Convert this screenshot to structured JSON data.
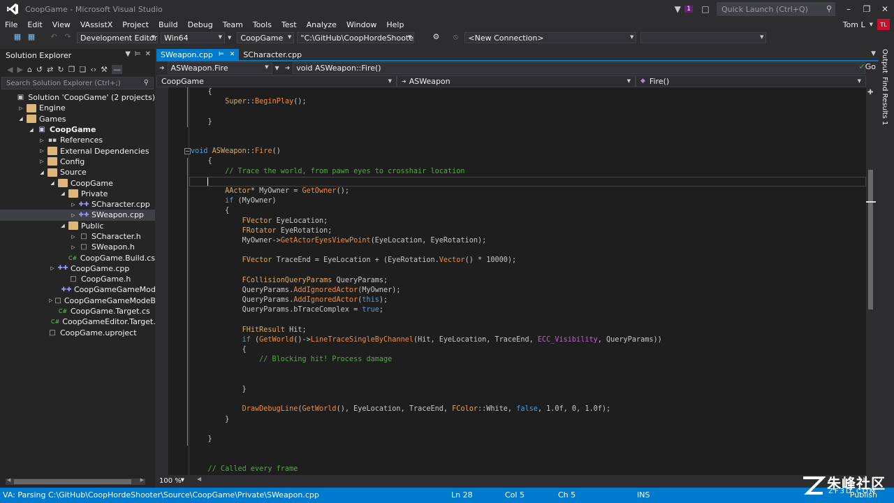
{
  "window": {
    "title": "CoopGame - Microsoft Visual Studio",
    "notification_count": "1",
    "quick_launch_placeholder": "Quick Launch (Ctrl+Q)"
  },
  "menu": {
    "items": [
      "File",
      "Edit",
      "View",
      "VAssistX",
      "Project",
      "Build",
      "Debug",
      "Team",
      "Tools",
      "Test",
      "Analyze",
      "Window",
      "Help"
    ],
    "user_name": "Tom L",
    "user_initials": "TL"
  },
  "toolbar": {
    "configuration": "Development Editor",
    "platform": "Win64",
    "startup_project": "CoopGame",
    "path": "\"C:\\GitHub\\CoopHordeShooter\\Co",
    "connection": "<New Connection>"
  },
  "solution_explorer": {
    "title": "Solution Explorer",
    "search_placeholder": "Search Solution Explorer (Ctrl+;)",
    "items": [
      {
        "label": "Solution 'CoopGame' (2 projects)",
        "indent": 0,
        "arrow": "",
        "icon": "solution"
      },
      {
        "label": "Engine",
        "indent": 1,
        "arrow": "right",
        "icon": "folder"
      },
      {
        "label": "Games",
        "indent": 1,
        "arrow": "down",
        "icon": "folder"
      },
      {
        "label": "CoopGame",
        "indent": 2,
        "arrow": "down",
        "icon": "project",
        "bold": true
      },
      {
        "label": "References",
        "indent": 3,
        "arrow": "right",
        "icon": "references"
      },
      {
        "label": "External Dependencies",
        "indent": 3,
        "arrow": "right",
        "icon": "folder"
      },
      {
        "label": "Config",
        "indent": 3,
        "arrow": "right",
        "icon": "folder"
      },
      {
        "label": "Source",
        "indent": 3,
        "arrow": "down",
        "icon": "folder"
      },
      {
        "label": "CoopGame",
        "indent": 4,
        "arrow": "down",
        "icon": "folder"
      },
      {
        "label": "Private",
        "indent": 5,
        "arrow": "down",
        "icon": "folder"
      },
      {
        "label": "SCharacter.cpp",
        "indent": 6,
        "arrow": "right",
        "icon": "cpp"
      },
      {
        "label": "SWeapon.cpp",
        "indent": 6,
        "arrow": "right",
        "icon": "cpp",
        "selected": true
      },
      {
        "label": "Public",
        "indent": 5,
        "arrow": "down",
        "icon": "folder"
      },
      {
        "label": "SCharacter.h",
        "indent": 6,
        "arrow": "right",
        "icon": "file"
      },
      {
        "label": "SWeapon.h",
        "indent": 6,
        "arrow": "right",
        "icon": "file"
      },
      {
        "label": "CoopGame.Build.cs",
        "indent": 5,
        "arrow": "",
        "icon": "cs"
      },
      {
        "label": "CoopGame.cpp",
        "indent": 4,
        "arrow": "right",
        "icon": "cpp"
      },
      {
        "label": "CoopGame.h",
        "indent": 5,
        "arrow": "",
        "icon": "file"
      },
      {
        "label": "CoopGameGameModeBa",
        "indent": 5,
        "arrow": "",
        "icon": "cpp"
      },
      {
        "label": "CoopGameGameModeBa",
        "indent": 4,
        "arrow": "right",
        "icon": "file"
      },
      {
        "label": "CoopGame.Target.cs",
        "indent": 4,
        "arrow": "",
        "icon": "cs"
      },
      {
        "label": "CoopGameEditor.Target.cs",
        "indent": 4,
        "arrow": "",
        "icon": "cs"
      },
      {
        "label": "CoopGame.uproject",
        "indent": 3,
        "arrow": "",
        "icon": "file"
      }
    ]
  },
  "editor": {
    "tabs": [
      {
        "label": "SWeapon.cpp",
        "active": true
      },
      {
        "label": "SCharacter.cpp",
        "active": false
      }
    ],
    "va_context": "ASWeapon.Fire",
    "va_definition": "void ASWeapon::Fire()",
    "va_go": "Go",
    "nav_project": "CoopGame",
    "nav_class": "ASWeapon",
    "nav_member": "Fire()",
    "zoom": "100 %",
    "code_lines": [
      [
        [
          "t-var",
          "    {"
        ]
      ],
      [
        [
          "t-var",
          "        "
        ],
        [
          "t-class",
          "Super"
        ],
        [
          "t-var",
          "::"
        ],
        [
          "t-fn",
          "BeginPlay"
        ],
        [
          "t-var",
          "();"
        ]
      ],
      [
        [
          "t-var",
          ""
        ]
      ],
      [
        [
          "t-var",
          "    }"
        ]
      ],
      [
        [
          "t-var",
          ""
        ]
      ],
      [
        [
          "t-var",
          ""
        ]
      ],
      [
        [
          "t-kw",
          "void "
        ],
        [
          "t-class",
          "ASWeapon"
        ],
        [
          "t-var",
          "::"
        ],
        [
          "t-fn",
          "Fire"
        ],
        [
          "t-var",
          "()"
        ]
      ],
      [
        [
          "t-var",
          "    {"
        ]
      ],
      [
        [
          "t-cm",
          "        // Trace the world, from pawn eyes to crosshair location"
        ]
      ],
      [
        [
          "t-var",
          ""
        ]
      ],
      [
        [
          "t-class",
          "        AActor"
        ],
        [
          "t-var",
          "* MyOwner = "
        ],
        [
          "t-fn",
          "GetOwner"
        ],
        [
          "t-var",
          "();"
        ]
      ],
      [
        [
          "t-kw",
          "        if "
        ],
        [
          "t-var",
          "(MyOwner)"
        ]
      ],
      [
        [
          "t-var",
          "        {"
        ]
      ],
      [
        [
          "t-class",
          "            FVector "
        ],
        [
          "t-var",
          "EyeLocation;"
        ]
      ],
      [
        [
          "t-class",
          "            FRotator "
        ],
        [
          "t-var",
          "EyeRotation;"
        ]
      ],
      [
        [
          "t-var",
          "            MyOwner->"
        ],
        [
          "t-fn",
          "GetActorEyesViewPoint"
        ],
        [
          "t-var",
          "(EyeLocation, EyeRotation);"
        ]
      ],
      [
        [
          "t-var",
          ""
        ]
      ],
      [
        [
          "t-class",
          "            FVector "
        ],
        [
          "t-var",
          "TraceEnd = EyeLocation + (EyeRotation."
        ],
        [
          "t-fn",
          "Vector"
        ],
        [
          "t-var",
          "() * 10000);"
        ]
      ],
      [
        [
          "t-var",
          ""
        ]
      ],
      [
        [
          "t-class",
          "            FCollisionQueryParams "
        ],
        [
          "t-var",
          "QueryParams;"
        ]
      ],
      [
        [
          "t-var",
          "            QueryParams."
        ],
        [
          "t-fn",
          "AddIgnoredActor"
        ],
        [
          "t-var",
          "(MyOwner);"
        ]
      ],
      [
        [
          "t-var",
          "            QueryParams."
        ],
        [
          "t-fn",
          "AddIgnoredActor"
        ],
        [
          "t-var",
          "("
        ],
        [
          "t-kw",
          "this"
        ],
        [
          "t-var",
          ");"
        ]
      ],
      [
        [
          "t-var",
          "            QueryParams.bTraceComplex = "
        ],
        [
          "t-kw",
          "true"
        ],
        [
          "t-var",
          ";"
        ]
      ],
      [
        [
          "t-var",
          ""
        ]
      ],
      [
        [
          "t-class",
          "            FHitResult "
        ],
        [
          "t-var",
          "Hit;"
        ]
      ],
      [
        [
          "t-kw",
          "            if "
        ],
        [
          "t-var",
          "("
        ],
        [
          "t-fn",
          "GetWorld"
        ],
        [
          "t-var",
          "()->"
        ],
        [
          "t-fn",
          "LineTraceSingleByChannel"
        ],
        [
          "t-var",
          "(Hit, EyeLocation, TraceEnd, "
        ],
        [
          "t-macro",
          "ECC_Visibility"
        ],
        [
          "t-var",
          ", QueryParams))"
        ]
      ],
      [
        [
          "t-var",
          "            {"
        ]
      ],
      [
        [
          "t-cm",
          "                // Blocking hit! Process damage"
        ]
      ],
      [
        [
          "t-var",
          ""
        ]
      ],
      [
        [
          "t-var",
          ""
        ]
      ],
      [
        [
          "t-var",
          "            }"
        ]
      ],
      [
        [
          "t-var",
          ""
        ]
      ],
      [
        [
          "t-fn",
          "            DrawDebugLine"
        ],
        [
          "t-var",
          "("
        ],
        [
          "t-fn",
          "GetWorld"
        ],
        [
          "t-var",
          "(), EyeLocation, TraceEnd, "
        ],
        [
          "t-class",
          "FColor"
        ],
        [
          "t-var",
          "::White, "
        ],
        [
          "t-kw",
          "false"
        ],
        [
          "t-var",
          ", 1.0f, 0, 1.0f);"
        ]
      ],
      [
        [
          "t-var",
          "        }"
        ]
      ],
      [
        [
          "t-var",
          ""
        ]
      ],
      [
        [
          "t-var",
          "    }"
        ]
      ],
      [
        [
          "t-var",
          ""
        ]
      ],
      [
        [
          "t-var",
          ""
        ]
      ],
      [
        [
          "t-cm",
          "    // Called every frame"
        ]
      ]
    ]
  },
  "right_panel": {
    "tabs": [
      "Output",
      "Find Results 1"
    ]
  },
  "status": {
    "message": "VA: Parsing C:\\GitHub\\CoopHordeShooter\\Source\\CoopGame\\Private\\SWeapon.cpp",
    "line": "Ln 28",
    "col": "Col 5",
    "ch": "Ch 5",
    "mode": "INS",
    "publish": "Publish"
  },
  "watermark": {
    "text": "朱峰社区",
    "sub": "ZF3D.COM"
  }
}
